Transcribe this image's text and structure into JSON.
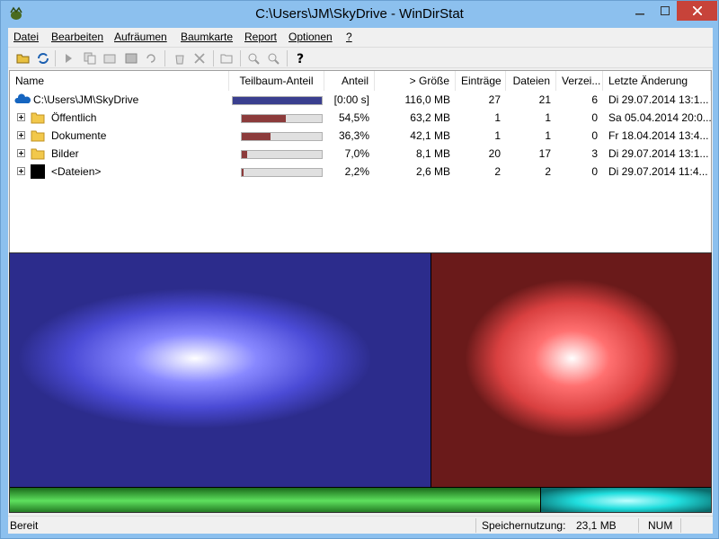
{
  "window": {
    "title": "C:\\Users\\JM\\SkyDrive - WinDirStat"
  },
  "menu": [
    "Datei",
    "Bearbeiten",
    "Aufräumen",
    "Baumkarte",
    "Report",
    "Optionen",
    "?"
  ],
  "columns": [
    "Name",
    "Teilbaum-Anteil",
    "Anteil",
    "> Größe",
    "Einträge",
    "Dateien",
    "Verzei...",
    "Letzte Änderung"
  ],
  "rows": [
    {
      "name": "C:\\Users\\JM\\SkyDrive",
      "subtree": 1.0,
      "share": "[0:00 s]",
      "size": "116,0 MB",
      "entries": "27",
      "files": "21",
      "dirs": "6",
      "modified": "Di 29.07.2014  13:1..."
    },
    {
      "name": "Öffentlich",
      "subtree": 0.545,
      "share": "54,5%",
      "size": "63,2 MB",
      "entries": "1",
      "files": "1",
      "dirs": "0",
      "modified": "Sa 05.04.2014  20:0..."
    },
    {
      "name": "Dokumente",
      "subtree": 0.363,
      "share": "36,3%",
      "size": "42,1 MB",
      "entries": "1",
      "files": "1",
      "dirs": "0",
      "modified": "Fr 18.04.2014  13:4..."
    },
    {
      "name": "Bilder",
      "subtree": 0.07,
      "share": "7,0%",
      "size": "8,1 MB",
      "entries": "20",
      "files": "17",
      "dirs": "3",
      "modified": "Di 29.07.2014  13:1..."
    },
    {
      "name": "<Dateien>",
      "subtree": 0.022,
      "share": "2,2%",
      "size": "2,6 MB",
      "entries": "2",
      "files": "2",
      "dirs": "0",
      "modified": "Di 29.07.2014  11:4..."
    }
  ],
  "status": {
    "left": "Bereit",
    "memory_label": "Speichernutzung:",
    "memory_value": "23,1 MB",
    "num": "NUM"
  },
  "colors": {
    "root_bar": "#3a3f8f",
    "sub_bar": "#8c3b3b",
    "treemap_blue": "#4040e0",
    "treemap_red": "#e03a3a",
    "treemap_green": "#2fbf2f",
    "treemap_cyan": "#1fd7d7"
  }
}
